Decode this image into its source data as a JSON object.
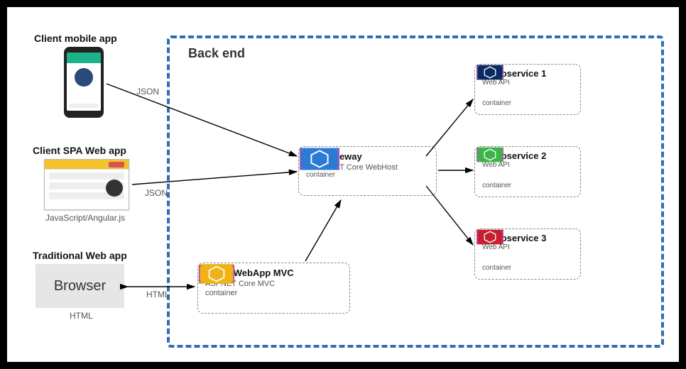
{
  "clients": {
    "mobile": {
      "title": "Client mobile app",
      "proto": "JSON"
    },
    "spa": {
      "title": "Client SPA Web app",
      "caption": "JavaScript/Angular.js",
      "proto": "JSON"
    },
    "trad": {
      "title": "Traditional Web app",
      "label": "Browser",
      "caption": "HTML",
      "proto": "HTML"
    }
  },
  "backend": {
    "title": "Back end",
    "gateway": {
      "title": "API Gateway",
      "sub": "ASPNET Core WebHost",
      "container": "container",
      "color": "#2b7bd4"
    },
    "mvc": {
      "title": "Client WebApp MVC",
      "sub": "ASPNET Core MVC container",
      "color": "#f0b216"
    },
    "ms": [
      {
        "title": "Microservice 1",
        "api": "Web API",
        "container": "container",
        "color": "#0a2a63"
      },
      {
        "title": "Microservice 2",
        "api": "Web API",
        "container": "container",
        "color": "#3bb54a"
      },
      {
        "title": "Microservice 3",
        "api": "Web API",
        "container": "container",
        "color": "#c4202f"
      }
    ]
  }
}
